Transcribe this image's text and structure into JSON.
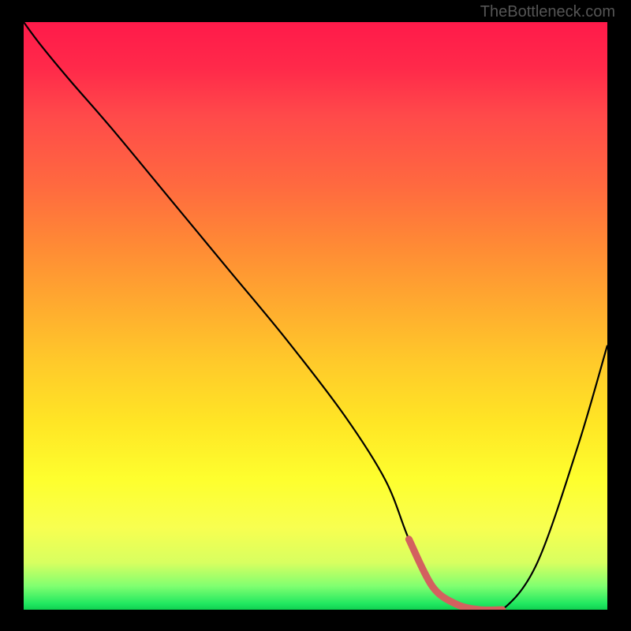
{
  "watermark": "TheBottleneck.com",
  "chart_data": {
    "type": "line",
    "title": "",
    "xlabel": "",
    "ylabel": "",
    "xlim": [
      0,
      100
    ],
    "ylim": [
      0,
      100
    ],
    "series": [
      {
        "name": "bottleneck-curve",
        "x": [
          0,
          3,
          8,
          15,
          25,
          35,
          45,
          55,
          62,
          66,
          70,
          74,
          78,
          82,
          88,
          95,
          100
        ],
        "y": [
          100,
          96,
          90,
          82,
          70,
          58,
          46,
          33,
          22,
          12,
          4,
          1,
          0,
          0,
          8,
          28,
          45
        ]
      },
      {
        "name": "highlight-segment",
        "x": [
          66,
          70,
          74,
          78,
          82
        ],
        "y": [
          12,
          4,
          1,
          0,
          0
        ]
      }
    ],
    "colors": {
      "curve": "#000000",
      "highlight": "#d3615f",
      "gradient_top": "#ff1a4a",
      "gradient_mid": "#ffe525",
      "gradient_bottom": "#10d050"
    }
  }
}
